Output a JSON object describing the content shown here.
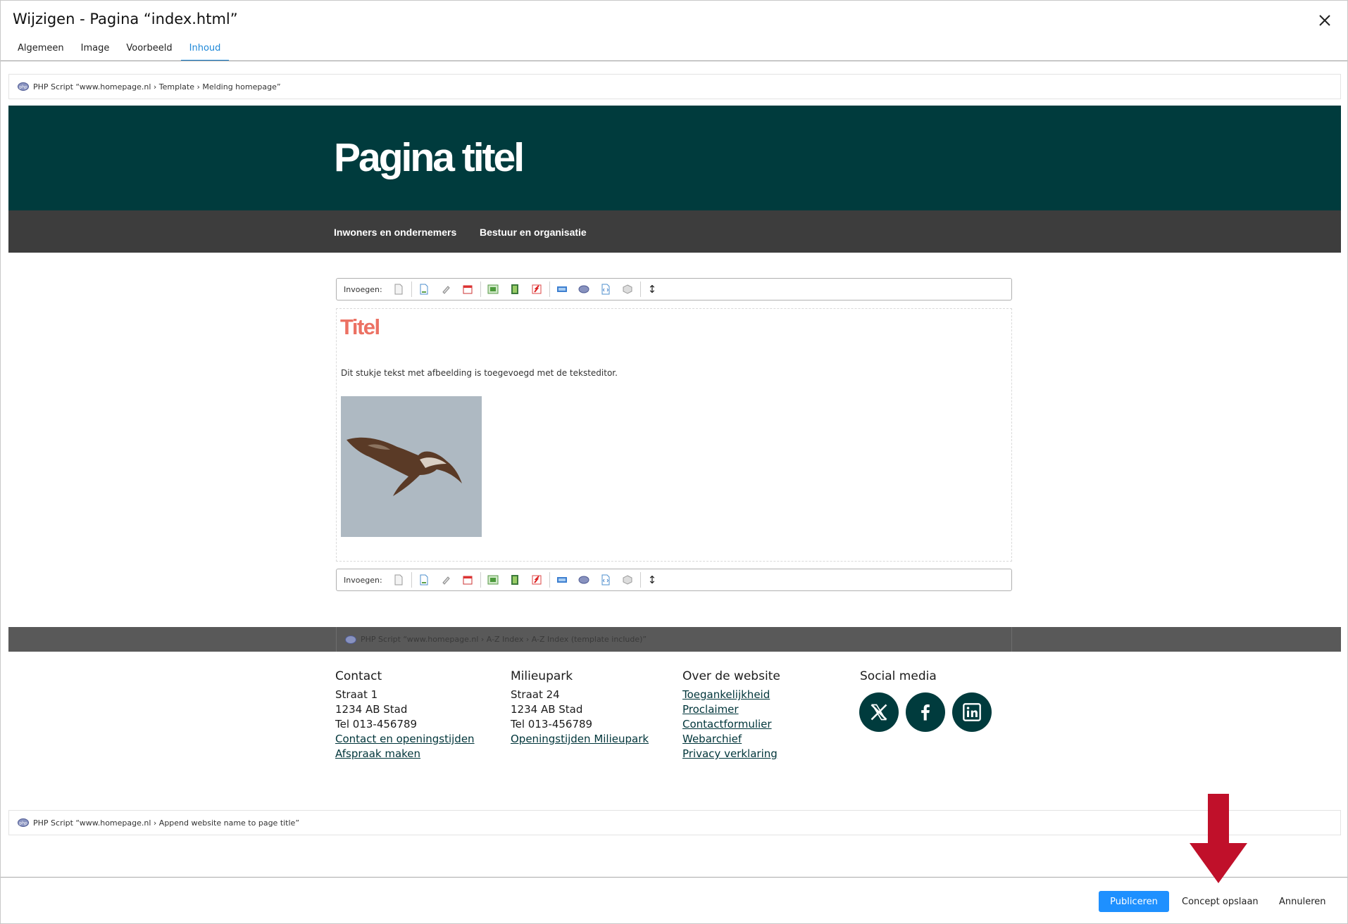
{
  "dialog": {
    "title": "Wijzigen - Pagina “index.html”",
    "tabs": [
      {
        "label": "Algemeen"
      },
      {
        "label": "Image"
      },
      {
        "label": "Voorbeeld"
      },
      {
        "label": "Inhoud",
        "active": true
      }
    ]
  },
  "php_top": {
    "label": "PHP Script “www.homepage.nl › Template › Melding homepage”"
  },
  "header": {
    "title": "Pagina titel"
  },
  "nav": {
    "items": [
      {
        "label": "Inwoners en ondernemers"
      },
      {
        "label": "Bestuur en organisatie"
      }
    ]
  },
  "toolbar": {
    "label": "Invoegen:",
    "icons": [
      "page-icon",
      "document-icon",
      "attachment-icon",
      "calendar-icon",
      "image-icon",
      "film-icon",
      "flash-icon",
      "html-icon",
      "php-icon",
      "code-icon",
      "box-icon"
    ],
    "arrows": "↕"
  },
  "content": {
    "title": "Titel",
    "text": "Dit stukje tekst met afbeelding is toegevoegd met de teksteditor."
  },
  "az_bar": {
    "label": "PHP Script “www.homepage.nl › A-Z Index › A-Z Index (template include)”"
  },
  "footer": {
    "contact": {
      "heading": "Contact",
      "lines": [
        "Straat 1",
        "1234 AB  Stad",
        "Tel 013-456789"
      ],
      "links": [
        "Contact en openingstijden",
        "Afspraak maken"
      ]
    },
    "milieupark": {
      "heading": "Milieupark",
      "lines": [
        "Straat 24",
        "1234 AB  Stad",
        "Tel 013-456789"
      ],
      "links": [
        "Openingstijden Milieupark"
      ]
    },
    "website": {
      "heading": "Over de website",
      "links": [
        "Toegankelijkheid",
        "Proclaimer",
        "Contactformulier",
        "Webarchief",
        "Privacy verklaring"
      ]
    },
    "social": {
      "heading": "Social media",
      "icons": [
        "x-icon",
        "facebook-icon",
        "linkedin-icon"
      ]
    }
  },
  "php_bottom": {
    "label": "PHP Script “www.homepage.nl › Append website name to page title”"
  },
  "actions": {
    "publish": "Publiceren",
    "save_draft": "Concept opslaan",
    "cancel": "Annuleren"
  },
  "colors": {
    "header_bg": "#003b3d",
    "nav_bg": "#3d3d3d",
    "accent_title": "#ec7163",
    "primary_button": "#1e90ff",
    "tab_active": "#1e88d8",
    "arrow": "#c0102a"
  }
}
